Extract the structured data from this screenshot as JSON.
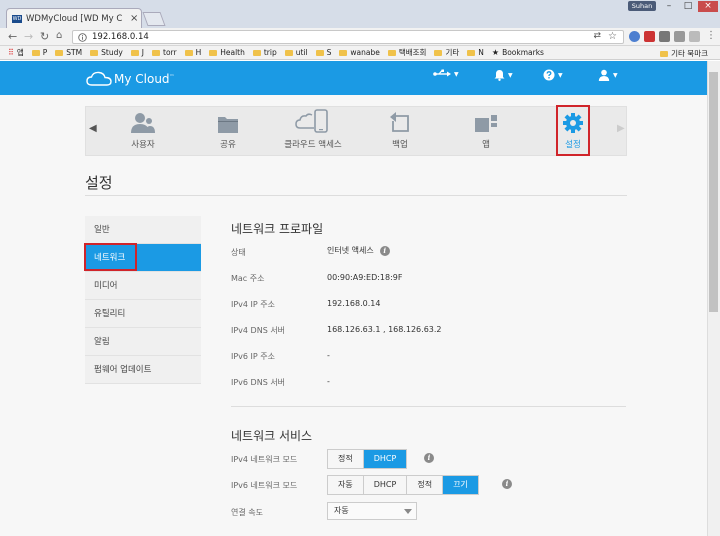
{
  "browser": {
    "tab_title": "WDMyCloud [WD My C",
    "tab_favicon": "WD",
    "user_label": "Suhan",
    "url": "192.168.0.14",
    "bookmarks": [
      {
        "label": "앱",
        "icon": "apps-icon"
      },
      {
        "label": "P",
        "icon": "folder-icon"
      },
      {
        "label": "STM",
        "icon": "folder-icon"
      },
      {
        "label": "Study",
        "icon": "folder-icon"
      },
      {
        "label": "J",
        "icon": "folder-icon"
      },
      {
        "label": "torr",
        "icon": "folder-icon"
      },
      {
        "label": "H",
        "icon": "folder-icon"
      },
      {
        "label": "Health",
        "icon": "folder-icon"
      },
      {
        "label": "trip",
        "icon": "folder-icon"
      },
      {
        "label": "util",
        "icon": "folder-icon"
      },
      {
        "label": "S",
        "icon": "folder-icon"
      },
      {
        "label": "wanabe",
        "icon": "folder-icon"
      },
      {
        "label": "택배조회",
        "icon": "folder-icon"
      },
      {
        "label": "기타",
        "icon": "folder-icon"
      },
      {
        "label": "N",
        "icon": "folder-icon"
      },
      {
        "label": "Bookmarks",
        "icon": "star-icon"
      }
    ],
    "other_bookmarks": "기타 북마크"
  },
  "app": {
    "brand": "My Cloud",
    "brand_mark": "™",
    "accent": "#1b9ae4",
    "highlight": "#d0242a"
  },
  "categories": [
    {
      "label": "사용자",
      "icon": "users-icon"
    },
    {
      "label": "공유",
      "icon": "folder-icon"
    },
    {
      "label": "클라우드 액세스",
      "icon": "cloud-devices-icon"
    },
    {
      "label": "백업",
      "icon": "backup-icon"
    },
    {
      "label": "앱",
      "icon": "apps-icon"
    },
    {
      "label": "설정",
      "icon": "gear-icon"
    }
  ],
  "page_title": "설정",
  "sidebar": [
    {
      "label": "일반"
    },
    {
      "label": "네트워크"
    },
    {
      "label": "미디어"
    },
    {
      "label": "유틸리티"
    },
    {
      "label": "알림"
    },
    {
      "label": "펌웨어 업데이트"
    }
  ],
  "network_profile": {
    "title": "네트워크 프로파일",
    "rows": [
      {
        "label": "상태",
        "value": "인터넷 액세스"
      },
      {
        "label": "Mac 주소",
        "value": "00:90:A9:ED:18:9F"
      },
      {
        "label": "IPv4 IP 주소",
        "value": "192.168.0.14"
      },
      {
        "label": "IPv4 DNS 서버",
        "value": "168.126.63.1 , 168.126.63.2"
      },
      {
        "label": "IPv6 IP 주소",
        "value": "-"
      },
      {
        "label": "IPv6 DNS 서버",
        "value": "-"
      }
    ]
  },
  "network_services": {
    "title": "네트워크 서비스",
    "ipv4_label": "IPv4 네트워크 모드",
    "ipv4_options": [
      "정적",
      "DHCP"
    ],
    "ipv4_selected": "DHCP",
    "ipv6_label": "IPv6 네트워크 모드",
    "ipv6_options": [
      "자동",
      "DHCP",
      "정적",
      "끄기"
    ],
    "ipv6_selected": "끄기",
    "speed_label": "연결 속도",
    "speed_value": "자동"
  },
  "info_glyph": "i"
}
